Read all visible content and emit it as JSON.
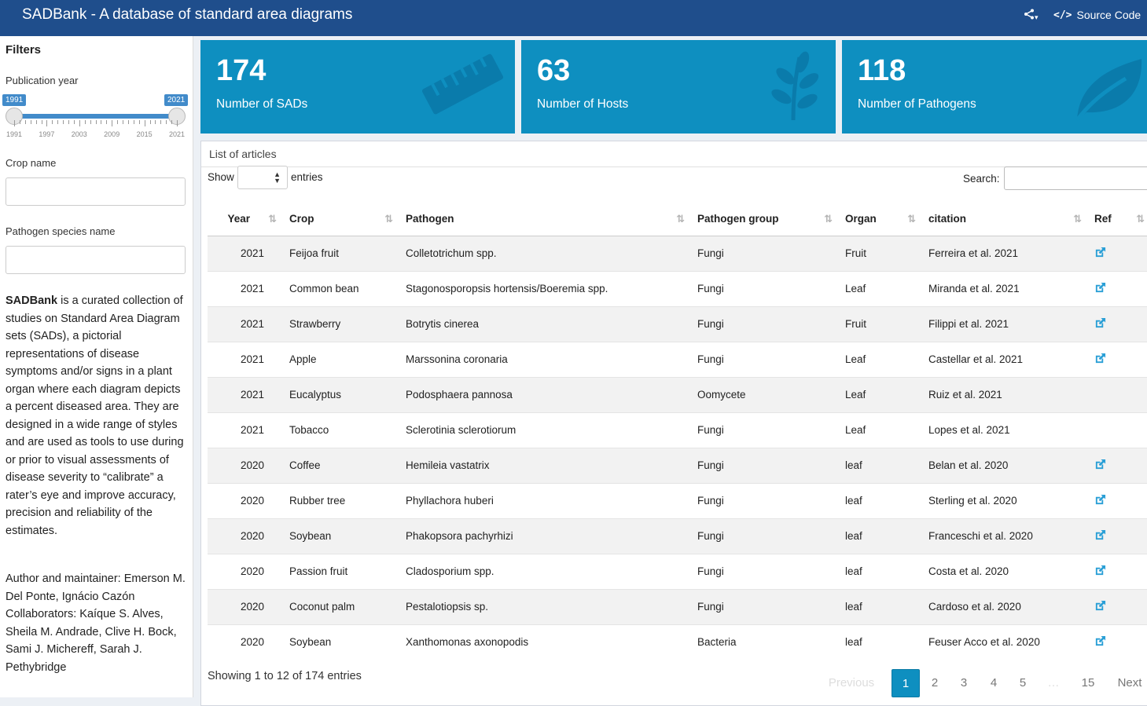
{
  "app": {
    "title": "SADBank - A database of standard area diagrams",
    "source_code_label": "Source Code"
  },
  "sidebar": {
    "filters_title": "Filters",
    "pub_year_label": "Publication year",
    "slider_min": "1991",
    "slider_max": "2021",
    "ticks": [
      "1991",
      "1997",
      "2003",
      "2009",
      "2015",
      "2021"
    ],
    "crop_label": "Crop name",
    "crop_value": "",
    "pathogen_label": "Pathogen species name",
    "pathogen_value": "",
    "desc_bold": "SADBank",
    "desc_rest": " is a curated collection of studies on Standard Area Diagram sets (SADs), a pictorial representations of disease symptoms and/or signs in a plant organ where each diagram depicts a percent diseased area. They are designed in a wide range of styles and are used as tools to use during or prior to visual assessments of disease severity to “calibrate” a rater’s eye and improve accuracy, precision and reliability of the estimates.",
    "author": "Author and maintainer: Emerson M. Del Ponte, Ignácio Cazón Collaborators: Kaíque S. Alves, Sheila M. Andrade, Clive H. Bock, Sami J. Michereff, Sarah J. Pethybridge"
  },
  "value_boxes": [
    {
      "value": "174",
      "label": "Number of SADs",
      "icon": "ruler-icon"
    },
    {
      "value": "63",
      "label": "Number of Hosts",
      "icon": "leaf-branch-icon"
    },
    {
      "value": "118",
      "label": "Number of Pathogens",
      "icon": "leaf-icon"
    }
  ],
  "table": {
    "panel_title": "List of articles",
    "show_label": "Show",
    "entries_label": "entries",
    "search_label": "Search:",
    "columns": [
      "Year",
      "Crop",
      "Pathogen",
      "Pathogen group",
      "Organ",
      "citation",
      "Ref"
    ],
    "rows": [
      {
        "year": "2021",
        "crop": "Feijoa fruit",
        "pathogen": "Colletotrichum spp.",
        "group": "Fungi",
        "organ": "Fruit",
        "citation": "Ferreira et al. 2021",
        "ref": true
      },
      {
        "year": "2021",
        "crop": "Common bean",
        "pathogen": "Stagonosporopsis hortensis/Boeremia spp.",
        "group": "Fungi",
        "organ": "Leaf",
        "citation": "Miranda et al. 2021",
        "ref": true
      },
      {
        "year": "2021",
        "crop": "Strawberry",
        "pathogen": "Botrytis cinerea",
        "group": "Fungi",
        "organ": "Fruit",
        "citation": "Filippi et al. 2021",
        "ref": true
      },
      {
        "year": "2021",
        "crop": "Apple",
        "pathogen": "Marssonina coronaria",
        "group": "Fungi",
        "organ": "Leaf",
        "citation": "Castellar et al. 2021",
        "ref": true
      },
      {
        "year": "2021",
        "crop": "Eucalyptus",
        "pathogen": "Podosphaera pannosa",
        "group": "Oomycete",
        "organ": "Leaf",
        "citation": "Ruiz et al. 2021",
        "ref": false
      },
      {
        "year": "2021",
        "crop": "Tobacco",
        "pathogen": "Sclerotinia sclerotiorum",
        "group": "Fungi",
        "organ": "Leaf",
        "citation": "Lopes et al. 2021",
        "ref": false
      },
      {
        "year": "2020",
        "crop": "Coffee",
        "pathogen": "Hemileia vastatrix",
        "group": "Fungi",
        "organ": "leaf",
        "citation": "Belan et al. 2020",
        "ref": true
      },
      {
        "year": "2020",
        "crop": "Rubber tree",
        "pathogen": "Phyllachora huberi",
        "group": "Fungi",
        "organ": "leaf",
        "citation": "Sterling et al. 2020",
        "ref": true
      },
      {
        "year": "2020",
        "crop": "Soybean",
        "pathogen": "Phakopsora pachyrhizi",
        "group": "Fungi",
        "organ": "leaf",
        "citation": "Franceschi et al. 2020",
        "ref": true
      },
      {
        "year": "2020",
        "crop": "Passion fruit",
        "pathogen": "Cladosporium spp.",
        "group": "Fungi",
        "organ": "leaf",
        "citation": "Costa et al. 2020",
        "ref": true
      },
      {
        "year": "2020",
        "crop": "Coconut palm",
        "pathogen": "Pestalotiopsis sp.",
        "group": "Fungi",
        "organ": "leaf",
        "citation": "Cardoso et al. 2020",
        "ref": true
      },
      {
        "year": "2020",
        "crop": "Soybean",
        "pathogen": "Xanthomonas axonopodis",
        "group": "Bacteria",
        "organ": "leaf",
        "citation": "Feuser Acco et al. 2020",
        "ref": true
      }
    ],
    "info": "Showing 1 to 12 of 174 entries",
    "pagination": [
      "Previous",
      "1",
      "2",
      "3",
      "4",
      "5",
      "…",
      "15",
      "Next"
    ]
  },
  "colors": {
    "header": "#1f4e8c",
    "accent": "#0e8fc0",
    "slider": "#428bca"
  }
}
